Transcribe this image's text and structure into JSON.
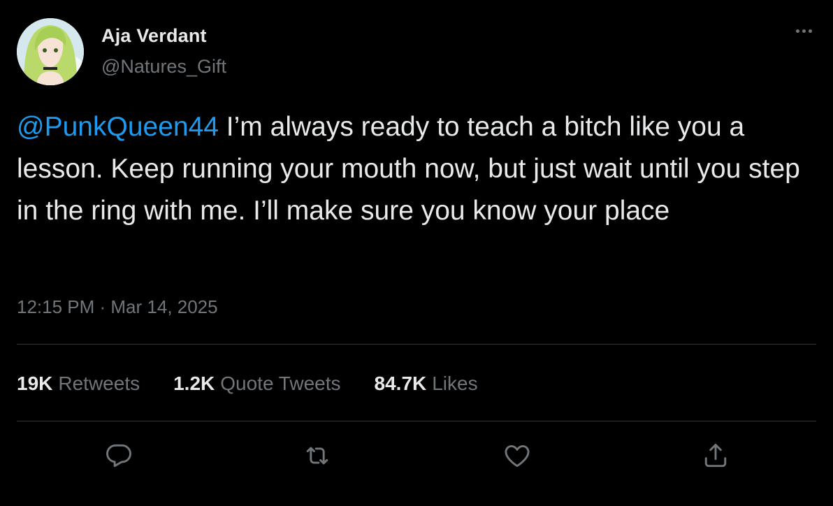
{
  "author": {
    "display_name": "Aja Verdant",
    "handle": "@Natures_Gift",
    "avatar_icon": "anime-avatar"
  },
  "tweet": {
    "mention": "@PunkQueen44",
    "body": " I’m always ready to teach a bitch like you a lesson. Keep running your mouth now, but just wait until you step in the ring with me. I’ll make sure you know your place",
    "timestamp": "12:15 PM · Mar 14, 2025"
  },
  "stats": {
    "retweets": {
      "count": "19K",
      "label": "Retweets"
    },
    "quotes": {
      "count": "1.2K",
      "label": "Quote Tweets"
    },
    "likes": {
      "count": "84.7K",
      "label": "Likes"
    }
  },
  "actions": [
    "reply-icon",
    "retweet-icon",
    "like-icon",
    "share-icon"
  ],
  "colors": {
    "background": "#000000",
    "text": "#e7e9ea",
    "muted": "#71767b",
    "accent": "#1d9bf0",
    "divider": "#2f3336"
  }
}
